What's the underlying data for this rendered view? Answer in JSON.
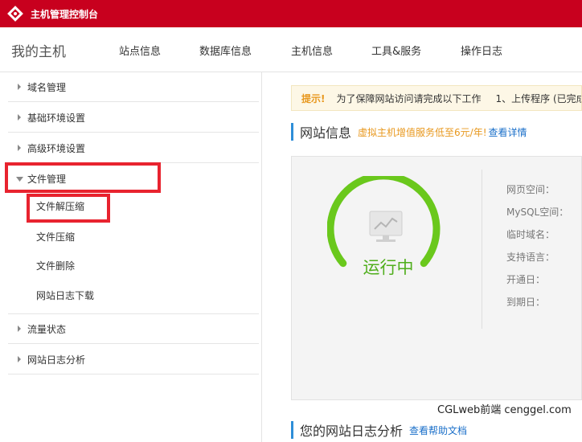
{
  "header": {
    "title": "主机管理控制台"
  },
  "nav": {
    "title": "我的主机",
    "items": [
      "站点信息",
      "数据库信息",
      "主机信息",
      "工具&服务",
      "操作日志"
    ]
  },
  "sidebar": {
    "groups": {
      "domain": "域名管理",
      "basic_env": "基础环境设置",
      "advanced_env": "高级环境设置",
      "file_mgmt": "文件管理",
      "traffic": "流量状态",
      "log_analysis": "网站日志分析"
    },
    "file_items": [
      "文件解压缩",
      "文件压缩",
      "文件删除",
      "网站日志下载"
    ]
  },
  "notice": {
    "label": "提示!",
    "text": "为了保障网站访问请完成以下工作",
    "step": "1、上传程序 (已完成"
  },
  "site_info": {
    "title": "网站信息",
    "promo": "虚拟主机增值服务低至6元/年!",
    "link": "查看详情",
    "status": "运行中",
    "labels": [
      "网页空间：",
      "MySQL空间：",
      "临时域名：",
      "支持语言：",
      "开通日：",
      "到期日："
    ]
  },
  "log_section": {
    "title": "您的网站日志分析",
    "link": "查看帮助文档"
  },
  "watermark": "CGLweb前端 cenggel.com",
  "colors": {
    "brand": "#c8001e",
    "accent_green": "#6ac81c",
    "highlight": "#e8232f",
    "link": "#1a6fc9"
  }
}
